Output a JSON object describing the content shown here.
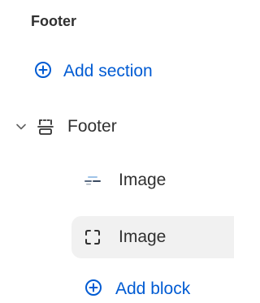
{
  "section": {
    "title": "Footer"
  },
  "add_section": {
    "label": "Add section",
    "icon": "plus-circle-icon"
  },
  "footer_group": {
    "label": "Footer",
    "chevron_icon": "chevron-down-icon",
    "icon": "footer-layout-icon"
  },
  "blocks": [
    {
      "label": "Image",
      "icon": "image-thumbnail-icon",
      "selected": false
    },
    {
      "label": "Image",
      "icon": "image-placeholder-icon",
      "selected": true
    }
  ],
  "add_block": {
    "label": "Add block",
    "icon": "plus-circle-icon"
  },
  "colors": {
    "accent": "#005bd3",
    "text": "#303030",
    "selected_bg": "#f1f1f1"
  }
}
